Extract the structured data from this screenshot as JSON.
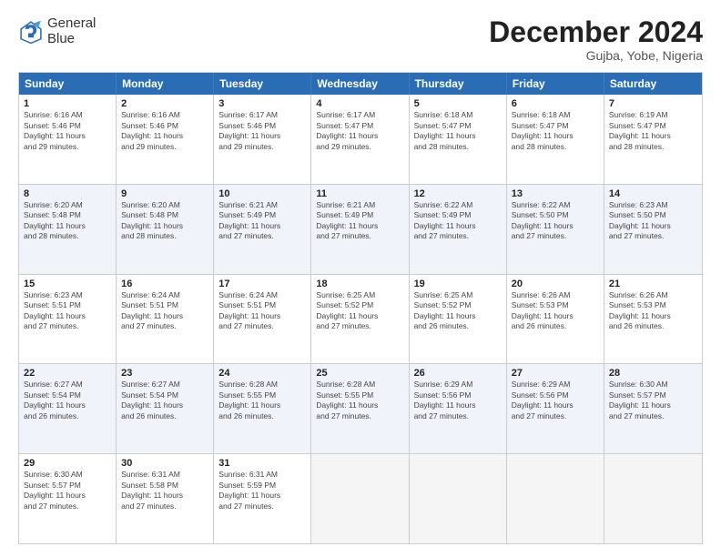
{
  "logo": {
    "line1": "General",
    "line2": "Blue"
  },
  "title": "December 2024",
  "location": "Gujba, Yobe, Nigeria",
  "header_days": [
    "Sunday",
    "Monday",
    "Tuesday",
    "Wednesday",
    "Thursday",
    "Friday",
    "Saturday"
  ],
  "weeks": [
    [
      {
        "day": "1",
        "lines": [
          "Sunrise: 6:16 AM",
          "Sunset: 5:46 PM",
          "Daylight: 11 hours",
          "and 29 minutes."
        ]
      },
      {
        "day": "2",
        "lines": [
          "Sunrise: 6:16 AM",
          "Sunset: 5:46 PM",
          "Daylight: 11 hours",
          "and 29 minutes."
        ]
      },
      {
        "day": "3",
        "lines": [
          "Sunrise: 6:17 AM",
          "Sunset: 5:46 PM",
          "Daylight: 11 hours",
          "and 29 minutes."
        ]
      },
      {
        "day": "4",
        "lines": [
          "Sunrise: 6:17 AM",
          "Sunset: 5:47 PM",
          "Daylight: 11 hours",
          "and 29 minutes."
        ]
      },
      {
        "day": "5",
        "lines": [
          "Sunrise: 6:18 AM",
          "Sunset: 5:47 PM",
          "Daylight: 11 hours",
          "and 28 minutes."
        ]
      },
      {
        "day": "6",
        "lines": [
          "Sunrise: 6:18 AM",
          "Sunset: 5:47 PM",
          "Daylight: 11 hours",
          "and 28 minutes."
        ]
      },
      {
        "day": "7",
        "lines": [
          "Sunrise: 6:19 AM",
          "Sunset: 5:47 PM",
          "Daylight: 11 hours",
          "and 28 minutes."
        ]
      }
    ],
    [
      {
        "day": "8",
        "lines": [
          "Sunrise: 6:20 AM",
          "Sunset: 5:48 PM",
          "Daylight: 11 hours",
          "and 28 minutes."
        ]
      },
      {
        "day": "9",
        "lines": [
          "Sunrise: 6:20 AM",
          "Sunset: 5:48 PM",
          "Daylight: 11 hours",
          "and 28 minutes."
        ]
      },
      {
        "day": "10",
        "lines": [
          "Sunrise: 6:21 AM",
          "Sunset: 5:49 PM",
          "Daylight: 11 hours",
          "and 27 minutes."
        ]
      },
      {
        "day": "11",
        "lines": [
          "Sunrise: 6:21 AM",
          "Sunset: 5:49 PM",
          "Daylight: 11 hours",
          "and 27 minutes."
        ]
      },
      {
        "day": "12",
        "lines": [
          "Sunrise: 6:22 AM",
          "Sunset: 5:49 PM",
          "Daylight: 11 hours",
          "and 27 minutes."
        ]
      },
      {
        "day": "13",
        "lines": [
          "Sunrise: 6:22 AM",
          "Sunset: 5:50 PM",
          "Daylight: 11 hours",
          "and 27 minutes."
        ]
      },
      {
        "day": "14",
        "lines": [
          "Sunrise: 6:23 AM",
          "Sunset: 5:50 PM",
          "Daylight: 11 hours",
          "and 27 minutes."
        ]
      }
    ],
    [
      {
        "day": "15",
        "lines": [
          "Sunrise: 6:23 AM",
          "Sunset: 5:51 PM",
          "Daylight: 11 hours",
          "and 27 minutes."
        ]
      },
      {
        "day": "16",
        "lines": [
          "Sunrise: 6:24 AM",
          "Sunset: 5:51 PM",
          "Daylight: 11 hours",
          "and 27 minutes."
        ]
      },
      {
        "day": "17",
        "lines": [
          "Sunrise: 6:24 AM",
          "Sunset: 5:51 PM",
          "Daylight: 11 hours",
          "and 27 minutes."
        ]
      },
      {
        "day": "18",
        "lines": [
          "Sunrise: 6:25 AM",
          "Sunset: 5:52 PM",
          "Daylight: 11 hours",
          "and 27 minutes."
        ]
      },
      {
        "day": "19",
        "lines": [
          "Sunrise: 6:25 AM",
          "Sunset: 5:52 PM",
          "Daylight: 11 hours",
          "and 26 minutes."
        ]
      },
      {
        "day": "20",
        "lines": [
          "Sunrise: 6:26 AM",
          "Sunset: 5:53 PM",
          "Daylight: 11 hours",
          "and 26 minutes."
        ]
      },
      {
        "day": "21",
        "lines": [
          "Sunrise: 6:26 AM",
          "Sunset: 5:53 PM",
          "Daylight: 11 hours",
          "and 26 minutes."
        ]
      }
    ],
    [
      {
        "day": "22",
        "lines": [
          "Sunrise: 6:27 AM",
          "Sunset: 5:54 PM",
          "Daylight: 11 hours",
          "and 26 minutes."
        ]
      },
      {
        "day": "23",
        "lines": [
          "Sunrise: 6:27 AM",
          "Sunset: 5:54 PM",
          "Daylight: 11 hours",
          "and 26 minutes."
        ]
      },
      {
        "day": "24",
        "lines": [
          "Sunrise: 6:28 AM",
          "Sunset: 5:55 PM",
          "Daylight: 11 hours",
          "and 26 minutes."
        ]
      },
      {
        "day": "25",
        "lines": [
          "Sunrise: 6:28 AM",
          "Sunset: 5:55 PM",
          "Daylight: 11 hours",
          "and 27 minutes."
        ]
      },
      {
        "day": "26",
        "lines": [
          "Sunrise: 6:29 AM",
          "Sunset: 5:56 PM",
          "Daylight: 11 hours",
          "and 27 minutes."
        ]
      },
      {
        "day": "27",
        "lines": [
          "Sunrise: 6:29 AM",
          "Sunset: 5:56 PM",
          "Daylight: 11 hours",
          "and 27 minutes."
        ]
      },
      {
        "day": "28",
        "lines": [
          "Sunrise: 6:30 AM",
          "Sunset: 5:57 PM",
          "Daylight: 11 hours",
          "and 27 minutes."
        ]
      }
    ],
    [
      {
        "day": "29",
        "lines": [
          "Sunrise: 6:30 AM",
          "Sunset: 5:57 PM",
          "Daylight: 11 hours",
          "and 27 minutes."
        ]
      },
      {
        "day": "30",
        "lines": [
          "Sunrise: 6:31 AM",
          "Sunset: 5:58 PM",
          "Daylight: 11 hours",
          "and 27 minutes."
        ]
      },
      {
        "day": "31",
        "lines": [
          "Sunrise: 6:31 AM",
          "Sunset: 5:59 PM",
          "Daylight: 11 hours",
          "and 27 minutes."
        ]
      },
      {
        "day": "",
        "lines": []
      },
      {
        "day": "",
        "lines": []
      },
      {
        "day": "",
        "lines": []
      },
      {
        "day": "",
        "lines": []
      }
    ]
  ]
}
